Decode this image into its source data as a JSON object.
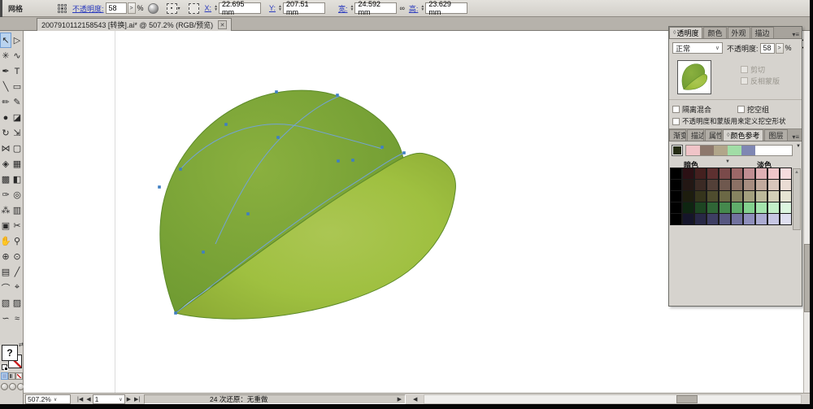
{
  "control_bar": {
    "object_label": "网格",
    "opacity_label": "不透明度:",
    "opacity_value": "58",
    "spinner_glyph": ">",
    "percent": "%",
    "fields": [
      {
        "label": "X:",
        "value": "22.695 mm"
      },
      {
        "label": "Y:",
        "value": "207.51 mm"
      },
      {
        "label": "宽:",
        "value": "24.592 mm"
      },
      {
        "label": "高:",
        "value": "23.629 mm"
      }
    ],
    "constrain_glyph": "∞"
  },
  "document_tab": {
    "title": "2007910112158543 [转换].ai* @ 507.2% (RGB/预览)",
    "close_glyph": "✕"
  },
  "toolbar": {
    "tools": [
      {
        "name": "selection-tool",
        "glyph": "↖",
        "active": true
      },
      {
        "name": "direct-selection-tool",
        "glyph": "▷"
      },
      {
        "name": "magic-wand-tool",
        "glyph": "✳"
      },
      {
        "name": "lasso-tool",
        "glyph": "∿"
      },
      {
        "name": "pen-tool",
        "glyph": "✒"
      },
      {
        "name": "type-tool",
        "glyph": "T"
      },
      {
        "name": "line-tool",
        "glyph": "╲"
      },
      {
        "name": "rectangle-tool",
        "glyph": "▭"
      },
      {
        "name": "paintbrush-tool",
        "glyph": "✏"
      },
      {
        "name": "pencil-tool",
        "glyph": "✎"
      },
      {
        "name": "blob-brush-tool",
        "glyph": "●"
      },
      {
        "name": "eraser-tool",
        "glyph": "◪"
      },
      {
        "name": "rotate-tool",
        "glyph": "↻"
      },
      {
        "name": "scale-tool",
        "glyph": "⇲"
      },
      {
        "name": "width-tool",
        "glyph": "⋈"
      },
      {
        "name": "free-transform-tool",
        "glyph": "▢"
      },
      {
        "name": "shape-builder-tool",
        "glyph": "◈"
      },
      {
        "name": "perspective-grid-tool",
        "glyph": "▦"
      },
      {
        "name": "mesh-tool",
        "glyph": "▩"
      },
      {
        "name": "gradient-tool",
        "glyph": "◧"
      },
      {
        "name": "eyedropper-tool",
        "glyph": "✑"
      },
      {
        "name": "blend-tool",
        "glyph": "◎"
      },
      {
        "name": "symbol-sprayer-tool",
        "glyph": "⁂"
      },
      {
        "name": "column-graph-tool",
        "glyph": "▥"
      },
      {
        "name": "artboard-tool",
        "glyph": "▣"
      },
      {
        "name": "slice-tool",
        "glyph": "✂"
      },
      {
        "name": "hand-tool",
        "glyph": "✋"
      },
      {
        "name": "zoom-tool",
        "glyph": "⚲"
      },
      {
        "name": "live-paint-tool",
        "glyph": "⊕"
      },
      {
        "name": "live-paint-selection-tool",
        "glyph": "⊙"
      },
      {
        "name": "crop-tool",
        "glyph": "▤"
      },
      {
        "name": "knife-tool",
        "glyph": "╱"
      },
      {
        "name": "arc-tool",
        "glyph": "⌒"
      },
      {
        "name": "measure-tool",
        "glyph": "⌖"
      },
      {
        "name": "page-tool",
        "glyph": "▧"
      },
      {
        "name": "print-tiling-tool",
        "glyph": "▨"
      },
      {
        "name": "warp-tool",
        "glyph": "∽"
      },
      {
        "name": "wrinkle-tool",
        "glyph": "≈"
      }
    ],
    "fill_indicator": "?",
    "swap_glyph": "⇄"
  },
  "panels": {
    "transparency": {
      "tabs": [
        {
          "label": "透明度",
          "active": true
        },
        {
          "label": "颜色"
        },
        {
          "label": "外观"
        },
        {
          "label": "描边"
        }
      ],
      "menu_glyph": "▾≡",
      "blend_mode": "正常",
      "blend_dd": "∨",
      "opacity_label": "不透明度:",
      "opacity_value": "58",
      "spinner_glyph": ">",
      "percent": "%",
      "clip_label": "剪切",
      "invert_label": "反相蒙版",
      "isolate_label": "隔离混合",
      "knockout_label": "挖空组",
      "define_label": "不透明度和蒙版用来定义挖空形状"
    },
    "color_guide": {
      "tabs": [
        {
          "label": "渐变"
        },
        {
          "label": "描边"
        },
        {
          "label": "属性"
        },
        {
          "label": "颜色参考",
          "active": true
        },
        {
          "label": "图层"
        }
      ],
      "menu_glyph": "▾≡",
      "base_color": "#262d15",
      "harmony_colors": [
        "#f0c4c8",
        "#8d786c",
        "#b1a68a",
        "#a1dda6",
        "#7f87b3"
      ],
      "harmony_dd": "▼",
      "dark_label": "暗色",
      "mid_marker": "▼",
      "light_label": "淡色",
      "grid": [
        [
          "#000000",
          "#2b1014",
          "#44201f",
          "#5d3030",
          "#7a4a4a",
          "#9c6868",
          "#c08e92",
          "#dfb0b4",
          "#eec6c9",
          "#f7dcde"
        ],
        [
          "#000000",
          "#231714",
          "#3b2a24",
          "#534038",
          "#6f584e",
          "#8b7165",
          "#a78d80",
          "#c2aa9d",
          "#d8c6bb",
          "#eadcd4"
        ],
        [
          "#000000",
          "#1d1d0e",
          "#35341c",
          "#4e4c2e",
          "#6b6845",
          "#878461",
          "#a3a07e",
          "#bcb99b",
          "#d2cfb8",
          "#e6e4d3"
        ],
        [
          "#000000",
          "#0e2511",
          "#1d4522",
          "#2f6636",
          "#45894d",
          "#60ad6b",
          "#83d18e",
          "#a3e3ac",
          "#c2efc8",
          "#ddf6e0"
        ],
        [
          "#000000",
          "#15152a",
          "#282846",
          "#3e3e63",
          "#575781",
          "#72729f",
          "#8f8fbc",
          "#ababd1",
          "#c6c6e3",
          "#dfdff0"
        ]
      ],
      "scroll_glyph": "▲"
    }
  },
  "status_bar": {
    "zoom_value": "507.2%",
    "zoom_dd": "∨",
    "nav_first": "|◀",
    "nav_prev": "◀",
    "artboard_value": "1",
    "artboard_dd": "∨",
    "nav_next": "▶",
    "nav_last": "▶|",
    "undo_text": "24 次还原：无重做",
    "undo_arrow": "▶",
    "scroll_left": "◀"
  },
  "canvas": {
    "leaf_back_colors": {
      "edge": "#6e9a31",
      "center": "#8ab03f"
    },
    "leaf_front_colors": {
      "center": "#abc653",
      "mid": "#9fc040",
      "edge": "#8cab35"
    },
    "outline_color": "#5c8a28",
    "path_color": "#72a3d6",
    "anchor_color": "#3f7fc2",
    "anchors": [
      [
        66,
        290
      ],
      [
        100,
        215
      ],
      [
        155,
        168
      ],
      [
        72,
        113
      ],
      [
        46,
        135
      ],
      [
        128,
        58
      ],
      [
        192,
        74
      ],
      [
        266,
        103
      ],
      [
        284,
        102
      ],
      [
        320,
        86
      ],
      [
        347,
        93
      ],
      [
        265,
        22
      ],
      [
        190,
        18
      ]
    ]
  }
}
